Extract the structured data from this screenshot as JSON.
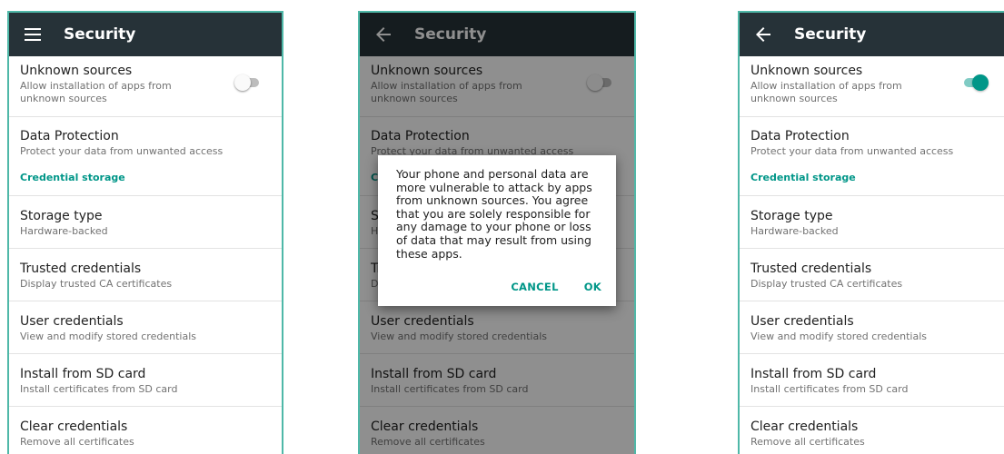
{
  "screens": [
    {
      "nav_icon": "hamburger-menu-icon",
      "title": "Security",
      "toggle_on": false,
      "dialog": false
    },
    {
      "nav_icon": "arrow-back-icon",
      "title": "Security",
      "toggle_on": false,
      "dialog": true
    },
    {
      "nav_icon": "arrow-back-icon",
      "title": "Security",
      "toggle_on": true,
      "dialog": false
    }
  ],
  "settings": {
    "unknown_sources": {
      "title": "Unknown sources",
      "subtitle": "Allow installation of apps from unknown sources"
    },
    "data_protection": {
      "title": "Data Protection",
      "subtitle": "Protect your data from unwanted access"
    },
    "credential_storage_header": "Credential storage",
    "storage_type": {
      "title": "Storage type",
      "subtitle": "Hardware-backed"
    },
    "trusted_credentials": {
      "title": "Trusted credentials",
      "subtitle": "Display trusted CA certificates"
    },
    "user_credentials": {
      "title": "User credentials",
      "subtitle": "View and modify stored credentials"
    },
    "install_sd": {
      "title": "Install from SD card",
      "subtitle": "Install certificates from SD card"
    },
    "clear_credentials": {
      "title": "Clear credentials",
      "subtitle": "Remove all certificates"
    }
  },
  "dialog": {
    "message": "Your phone and personal data are more vulnerable to attack by apps from unknown sources. You agree that you are solely responsible for any damage to your phone or loss of data that may result from using these apps.",
    "cancel_label": "CANCEL",
    "ok_label": "OK"
  },
  "colors": {
    "app_bar": "#263238",
    "accent": "#009688",
    "frame": "#4fb8a8",
    "divider": "#e3e3e3"
  }
}
